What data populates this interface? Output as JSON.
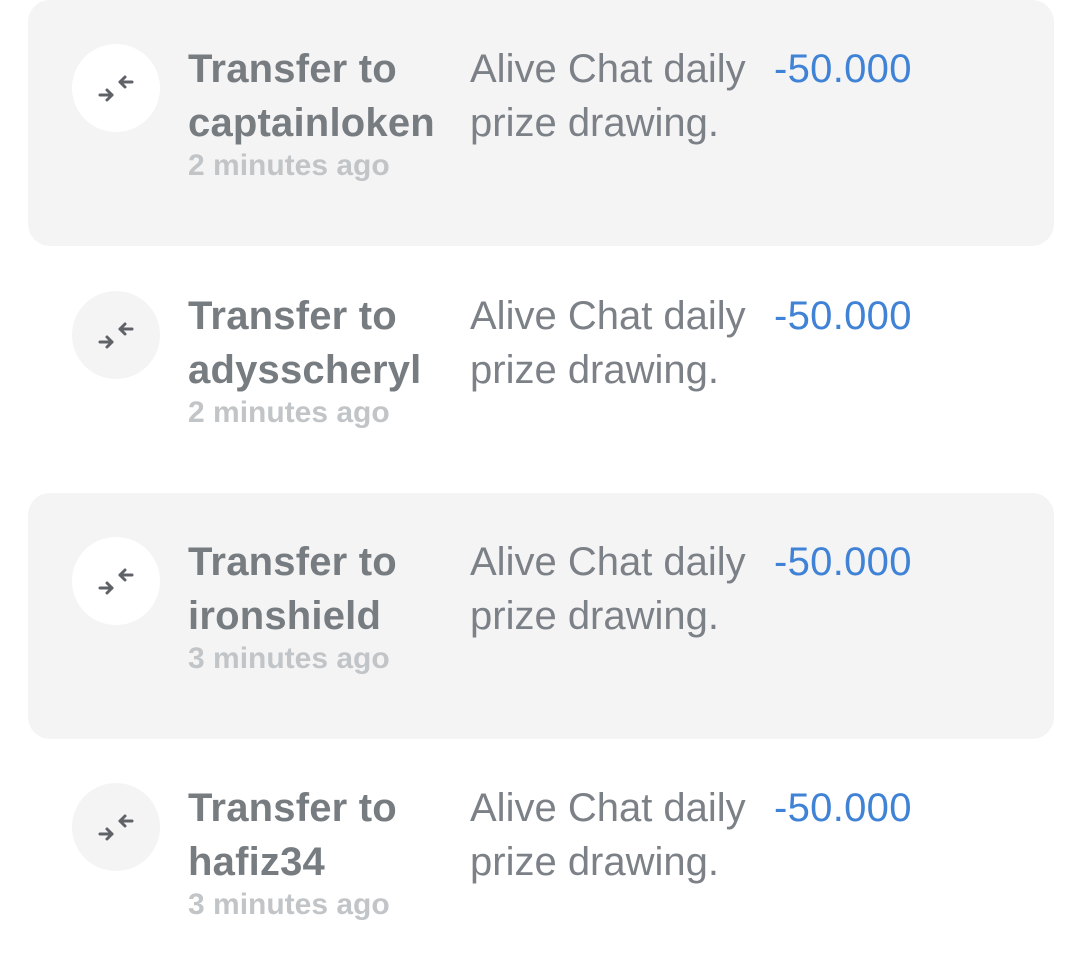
{
  "transactions": [
    {
      "title_prefix": "Transfer to",
      "recipient": "captainloken",
      "time": "2 minutes ago",
      "memo": "Alive Chat daily prize drawing.",
      "amount": "-50.000",
      "icon": "transfer-arrows-icon"
    },
    {
      "title_prefix": "Transfer to",
      "recipient": "adysscheryl",
      "time": "2 minutes ago",
      "memo": "Alive Chat daily prize drawing.",
      "amount": "-50.000",
      "icon": "transfer-arrows-icon"
    },
    {
      "title_prefix": "Transfer to",
      "recipient": "ironshield",
      "time": "3 minutes ago",
      "memo": "Alive Chat daily prize drawing.",
      "amount": "-50.000",
      "icon": "transfer-arrows-icon"
    },
    {
      "title_prefix": "Transfer to",
      "recipient": "hafiz34",
      "time": "3 minutes ago",
      "memo": "Alive Chat daily prize drawing.",
      "amount": "-50.000",
      "icon": "transfer-arrows-icon"
    }
  ],
  "colors": {
    "shaded_row_bg": "#f4f4f5",
    "title": "#777c81",
    "time": "#c2c5c8",
    "memo": "#7c8187",
    "amount": "#3f82d6",
    "icon": "#5f6368"
  }
}
